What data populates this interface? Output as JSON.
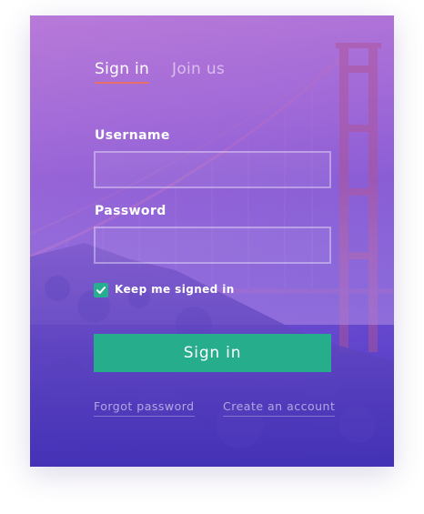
{
  "tabs": [
    {
      "label": "Sign in",
      "active": true
    },
    {
      "label": "Join us",
      "active": false
    }
  ],
  "form": {
    "username_label": "Username",
    "username_value": "",
    "password_label": "Password",
    "password_value": "",
    "keep_signed_in_label": "Keep me signed in",
    "keep_signed_in_checked": true,
    "submit_label": "Sign in"
  },
  "links": {
    "forgot_password": "Forgot password",
    "create_account": "Create an account"
  },
  "colors": {
    "accent_green": "#26ad8c",
    "tab_underline": "#e8706a",
    "gradient_top": "#b67ad8",
    "gradient_bottom": "#4f3cc0"
  },
  "background": {
    "icon": "golden-gate-bridge-photo"
  }
}
